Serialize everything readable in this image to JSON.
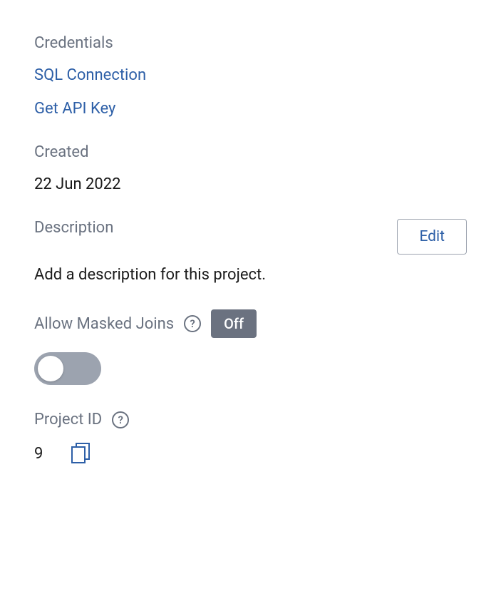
{
  "credentials": {
    "label": "Credentials",
    "links": {
      "sql": "SQL Connection",
      "api": "Get API Key"
    }
  },
  "created": {
    "label": "Created",
    "value": "22 Jun 2022"
  },
  "description": {
    "label": "Description",
    "edit_label": "Edit",
    "placeholder": "Add a description for this project."
  },
  "masked_joins": {
    "label": "Allow Masked Joins",
    "badge": "Off",
    "enabled": false
  },
  "project_id": {
    "label": "Project ID",
    "value": "9"
  }
}
